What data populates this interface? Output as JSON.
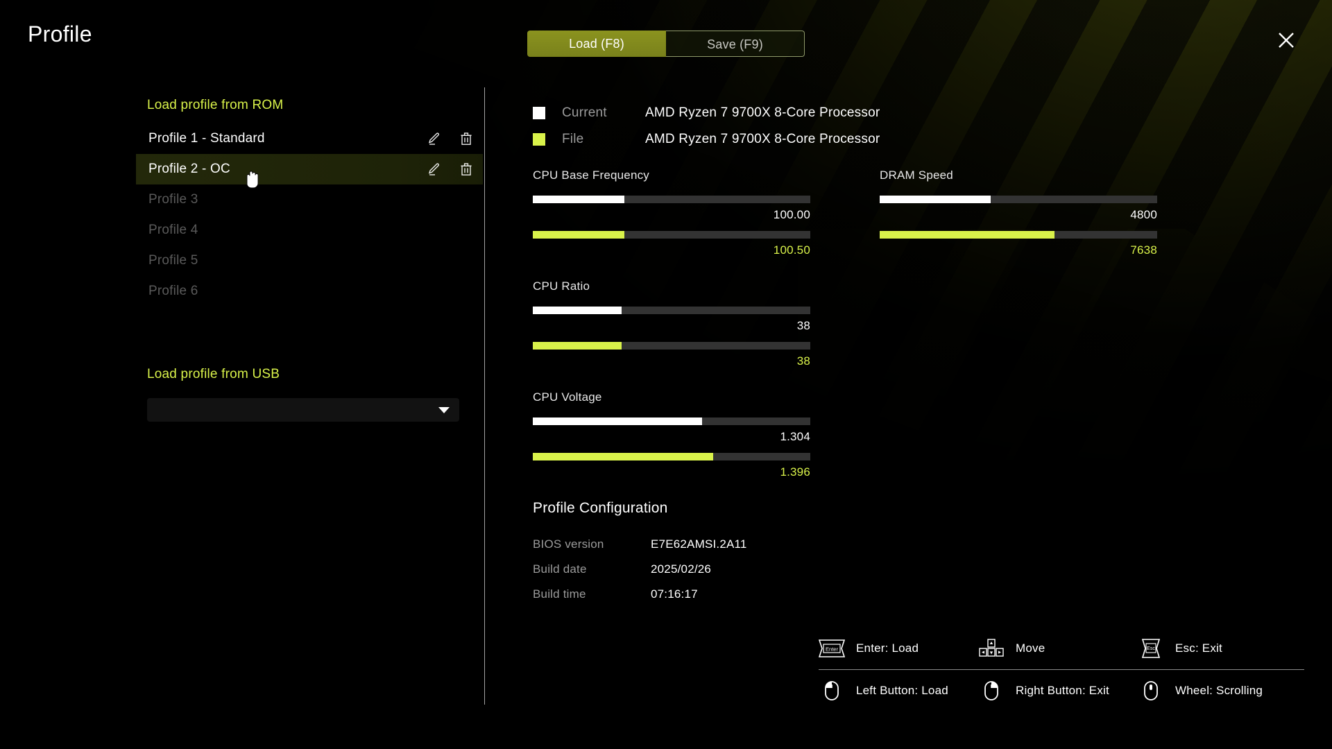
{
  "header": {
    "title": "Profile",
    "tabs": [
      {
        "label": "Load (F8)",
        "state": "active"
      },
      {
        "label": "Save (F9)",
        "state": "inactive"
      }
    ],
    "close_icon": "close-icon"
  },
  "left": {
    "rom_section_title": "Load profile from ROM",
    "profiles": [
      {
        "label": "Profile 1 - Standard",
        "state": "filled",
        "edit_icon": "pencil-icon",
        "delete_icon": "trash-icon"
      },
      {
        "label": "Profile 2 - OC",
        "state": "selected",
        "edit_icon": "pencil-icon",
        "delete_icon": "trash-icon"
      },
      {
        "label": "Profile 3",
        "state": "empty"
      },
      {
        "label": "Profile 4",
        "state": "empty"
      },
      {
        "label": "Profile 5",
        "state": "empty"
      },
      {
        "label": "Profile 6",
        "state": "empty"
      }
    ],
    "usb_section_title": "Load profile from USB",
    "usb_select": {
      "value": "",
      "placeholder": "",
      "caret_icon": "chevron-down-icon"
    }
  },
  "legend": {
    "current": {
      "label": "Current",
      "value": "AMD Ryzen 7 9700X 8-Core Processor",
      "color": "#ffffff"
    },
    "file": {
      "label": "File",
      "value": "AMD Ryzen 7 9700X 8-Core Processor",
      "color": "#d9f24a"
    }
  },
  "chart_data": {
    "type": "bar",
    "title": "Profile comparison: Current vs File",
    "orientation": "horizontal",
    "grid": false,
    "legend_position": "top",
    "series": [
      {
        "name": "Current",
        "color": "#ffffff"
      },
      {
        "name": "File",
        "color": "#d9f24a"
      }
    ],
    "metrics": [
      {
        "name": "CPU Base Frequency",
        "current": {
          "value": "100.00",
          "pct": 33
        },
        "file": {
          "value": "100.50",
          "pct": 33
        }
      },
      {
        "name": "CPU Ratio",
        "current": {
          "value": "38",
          "pct": 32
        },
        "file": {
          "value": "38",
          "pct": 32
        }
      },
      {
        "name": "CPU Voltage",
        "current": {
          "value": "1.304",
          "pct": 61
        },
        "file": {
          "value": "1.396",
          "pct": 65
        }
      },
      {
        "name": "DRAM Speed",
        "current": {
          "value": "4800",
          "pct": 40
        },
        "file": {
          "value": "7638",
          "pct": 63
        }
      }
    ]
  },
  "config": {
    "title": "Profile Configuration",
    "rows": [
      {
        "key": "BIOS version",
        "value": "E7E62AMSI.2A11"
      },
      {
        "key": "Build date",
        "value": "2025/02/26"
      },
      {
        "key": "Build time",
        "value": "07:16:17"
      }
    ]
  },
  "hints": {
    "row1": [
      {
        "glyph": "enter-key-icon",
        "text": "Enter: Load"
      },
      {
        "glyph": "arrow-keys-icon",
        "text": "Move"
      },
      {
        "glyph": "esc-key-icon",
        "text": "Esc: Exit"
      }
    ],
    "row2": [
      {
        "glyph": "mouse-left-icon",
        "text": "Left Button: Load"
      },
      {
        "glyph": "mouse-right-icon",
        "text": "Right Button: Exit"
      },
      {
        "glyph": "mouse-wheel-icon",
        "text": "Wheel: Scrolling"
      }
    ]
  },
  "colors": {
    "accent": "#d9f24a",
    "tab_active_bg": "#8b931f",
    "track": "#333333",
    "selected_row": "#23280a"
  }
}
